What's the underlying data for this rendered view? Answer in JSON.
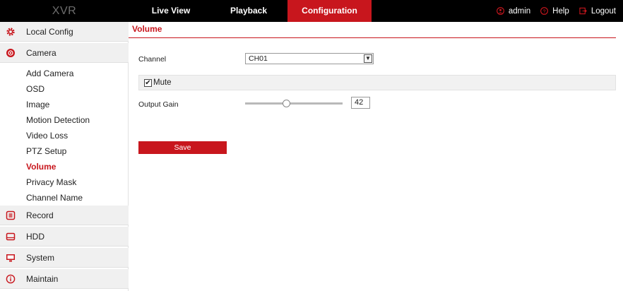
{
  "app": {
    "logo": "XVR"
  },
  "nav": {
    "tabs": [
      {
        "label": "Live View"
      },
      {
        "label": "Playback"
      },
      {
        "label": "Configuration"
      }
    ],
    "user": "admin",
    "help": "Help",
    "logout": "Logout"
  },
  "sidebar": {
    "local_config": "Local Config",
    "camera": "Camera",
    "camera_items": [
      "Add Camera",
      "OSD",
      "Image",
      "Motion Detection",
      "Video Loss",
      "PTZ Setup",
      "Volume",
      "Privacy Mask",
      "Channel Name"
    ],
    "record": "Record",
    "hdd": "HDD",
    "system": "System",
    "maintain": "Maintain"
  },
  "content": {
    "title": "Volume",
    "channel_label": "Channel",
    "channel_value": "CH01",
    "mute_label": "Mute",
    "mute_checked": true,
    "gain_label": "Output Gain",
    "gain_value": "42",
    "gain_fraction": 0.42,
    "save_label": "Save"
  },
  "colors": {
    "accent": "#c8161d",
    "topbar": "#000000"
  }
}
